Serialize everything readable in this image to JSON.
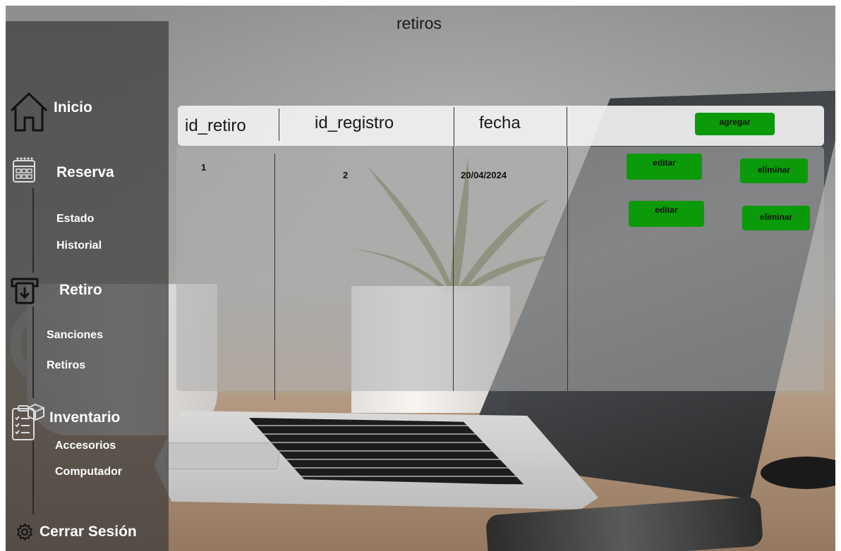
{
  "page": {
    "title": "retiros"
  },
  "sidebar": {
    "inicio": {
      "label": "Inicio",
      "icon": "home-icon"
    },
    "reserva": {
      "label": "Reserva",
      "icon": "calendar-icon",
      "items": [
        "Estado",
        "Historial"
      ]
    },
    "retiro": {
      "label": "Retiro",
      "icon": "inbox-download-icon",
      "items": [
        "Sanciones",
        "Retiros"
      ]
    },
    "inventario": {
      "label": "Inventario",
      "icon": "clipboard-box-icon",
      "items": [
        "Accesorios",
        "Computador"
      ]
    },
    "logout": {
      "label": "Cerrar Sesión",
      "icon": "gear-icon"
    }
  },
  "table": {
    "columns": [
      "id_retiro",
      "id_registro",
      "fecha"
    ],
    "add_button": "agregar",
    "rows": [
      {
        "id_retiro": "1",
        "id_registro": "2",
        "fecha": "20/04/2024"
      }
    ],
    "edit_label": "editar",
    "delete_label": "eliminar"
  },
  "colors": {
    "button_green": "#0a9a0a",
    "sidebar": "#3c3c3c"
  }
}
